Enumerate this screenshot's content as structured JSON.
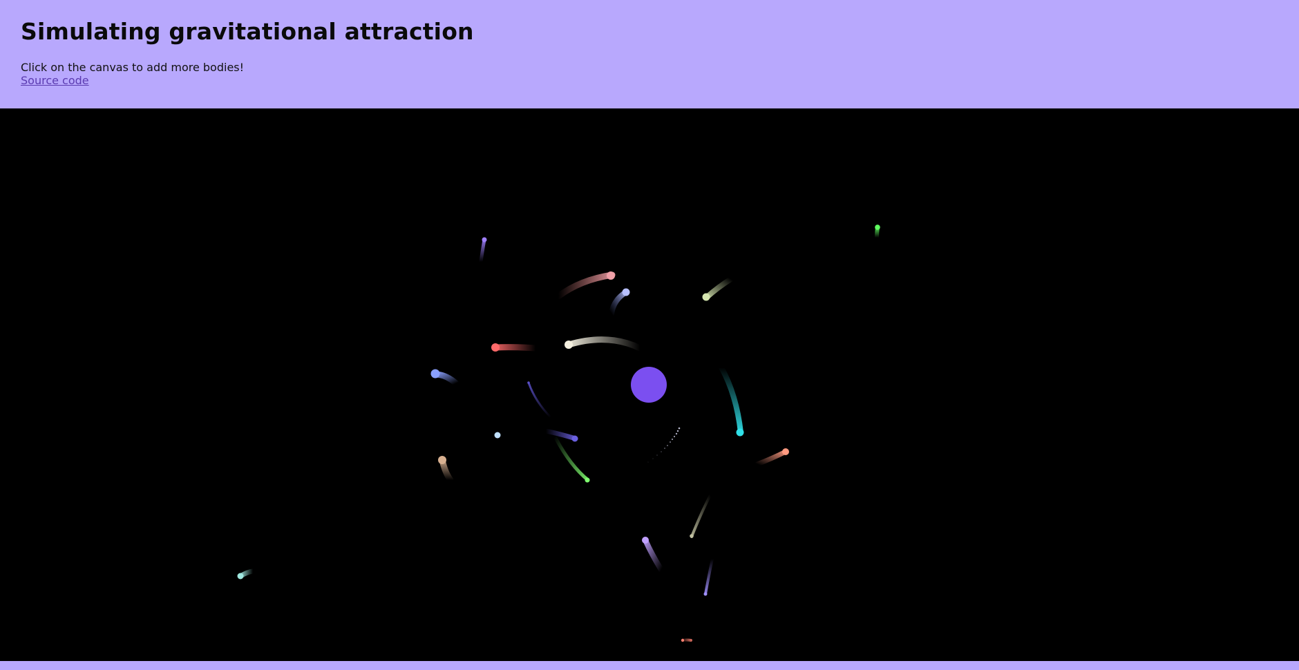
{
  "header": {
    "title": "Simulating gravitational attraction",
    "instruction": "Click on the canvas to add more bodies!",
    "source_link_label": "Source code"
  },
  "colors": {
    "background_accent": "#b8a8fd",
    "canvas_background": "#000000",
    "central_body": "#7b4ff0",
    "link": "#5b3bb0"
  },
  "bodies": [
    {
      "color": "#f08a86",
      "tail": "#c86070"
    },
    {
      "color": "#b8c0ff",
      "tail": "#5a6cc8"
    },
    {
      "color": "#d6e6b0",
      "tail": "#8a9a70"
    },
    {
      "color": "#ff6a6a",
      "tail": "#b04040"
    },
    {
      "color": "#f4f0e0",
      "tail": "#a8a090"
    },
    {
      "color": "#a080ff",
      "tail": "#6040b0"
    },
    {
      "color": "#8aa0ff",
      "tail": "#4050a0"
    },
    {
      "color": "#5a50c8",
      "tail": "#3a3080"
    },
    {
      "color": "#30e0e8",
      "tail": "#208090"
    },
    {
      "color": "#c0e0ff",
      "tail": "#8090b0"
    },
    {
      "color": "#6a60e0",
      "tail": "#3a3090"
    },
    {
      "color": "#80ff70",
      "tail": "#308040"
    },
    {
      "color": "#d8b090",
      "tail": "#806050"
    },
    {
      "color": "#ff9a80",
      "tail": "#b05050"
    },
    {
      "color": "#c0c0a0",
      "tail": "#707060"
    },
    {
      "color": "#c0a0ff",
      "tail": "#7050c0"
    },
    {
      "color": "#a090ff",
      "tail": "#6050c0"
    },
    {
      "color": "#a0e8e0",
      "tail": "#508080"
    },
    {
      "color": "#60ff60",
      "tail": "#30a030"
    },
    {
      "color": "#ff8070",
      "tail": "#904040"
    }
  ]
}
